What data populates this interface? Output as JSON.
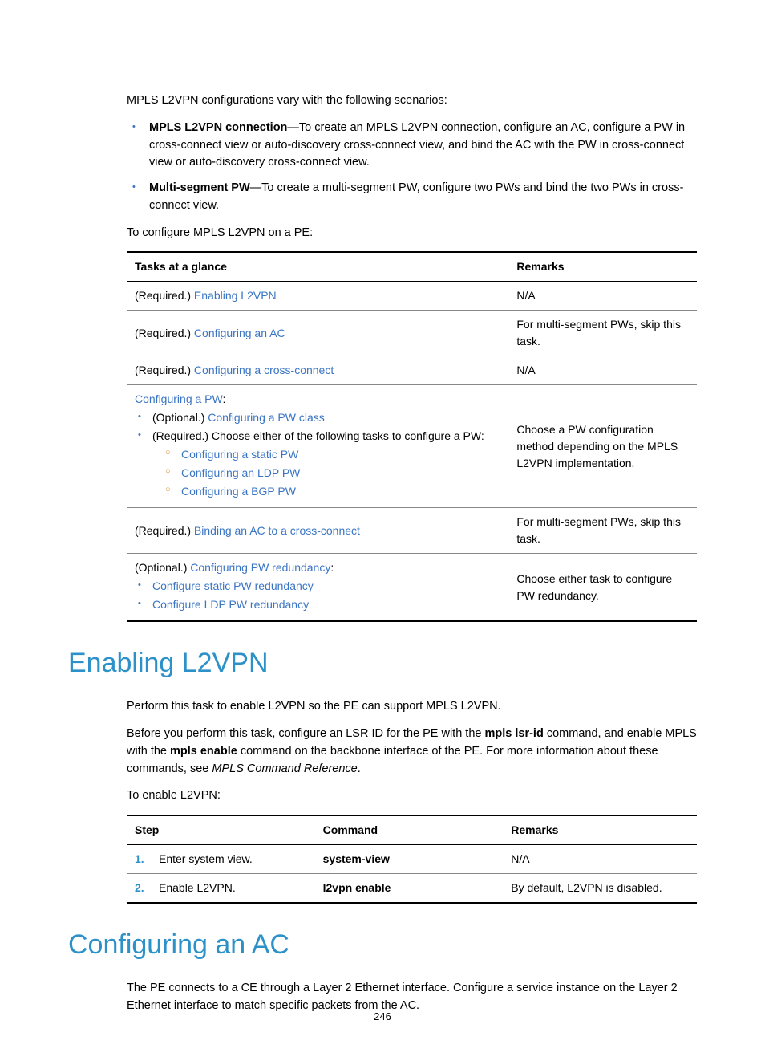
{
  "intro": {
    "p1": "MPLS L2VPN configurations vary with the following scenarios:",
    "bullet1_bold": "MPLS L2VPN connection",
    "bullet1_rest": "—To create an MPLS L2VPN connection, configure an AC, configure a PW in cross-connect view or auto-discovery cross-connect view, and bind the AC with the PW in cross-connect view or auto-discovery cross-connect view.",
    "bullet2_bold": "Multi-segment PW",
    "bullet2_rest": "—To create a multi-segment PW, configure two PWs and bind the two PWs in cross-connect view.",
    "p2": "To configure MPLS L2VPN on a PE:"
  },
  "table1": {
    "h1": "Tasks at a glance",
    "h2": "Remarks",
    "r1_prefix": "(Required.) ",
    "r1_link": "Enabling L2VPN",
    "r1_remark": "N/A",
    "r2_prefix": "(Required.) ",
    "r2_link": "Configuring an AC",
    "r2_remark": "For multi-segment PWs, skip this task.",
    "r3_prefix": "(Required.) ",
    "r3_link": "Configuring a cross-connect",
    "r3_remark": "N/A",
    "r4_link": "Configuring a PW",
    "r4_colon": ":",
    "r4_b1_prefix": "(Optional.) ",
    "r4_b1_link": "Configuring a PW class",
    "r4_b2_text": "(Required.) Choose either of the following tasks to configure a PW:",
    "r4_c1": "Configuring a static PW",
    "r4_c2": "Configuring an LDP PW",
    "r4_c3": "Configuring a BGP PW",
    "r4_remark": "Choose a PW configuration method depending on the MPLS L2VPN implementation.",
    "r5_prefix": "(Required.) ",
    "r5_link": "Binding an AC to a cross-connect",
    "r5_remark": "For multi-segment PWs, skip this task.",
    "r6_prefix": "(Optional.) ",
    "r6_link": "Configuring PW redundancy",
    "r6_colon": ":",
    "r6_b1": "Configure static PW redundancy",
    "r6_b2": "Configure LDP PW redundancy",
    "r6_remark": "Choose either task to configure PW redundancy."
  },
  "sec1": {
    "title": "Enabling L2VPN",
    "p1": "Perform this task to enable L2VPN so the PE can support MPLS L2VPN.",
    "p2a": "Before you perform this task, configure an LSR ID for the PE with the ",
    "p2b": "mpls lsr-id",
    "p2c": " command, and enable MPLS with the ",
    "p2d": "mpls enable",
    "p2e": " command on the backbone interface of the PE. For more information about these commands, see ",
    "p2f": "MPLS Command Reference",
    "p2g": ".",
    "p3": "To enable L2VPN:"
  },
  "table2": {
    "h1": "Step",
    "h2": "Command",
    "h3": "Remarks",
    "r1_n": "1.",
    "r1_step": "Enter system view.",
    "r1_cmd": "system-view",
    "r1_remark": "N/A",
    "r2_n": "2.",
    "r2_step": "Enable L2VPN.",
    "r2_cmd": "l2vpn enable",
    "r2_remark": "By default, L2VPN is disabled."
  },
  "sec2": {
    "title": "Configuring an AC",
    "p1": "The PE connects to a CE through a Layer 2 Ethernet interface. Configure a service instance on the Layer 2 Ethernet interface to match specific packets from the AC."
  },
  "pagenum": "246"
}
